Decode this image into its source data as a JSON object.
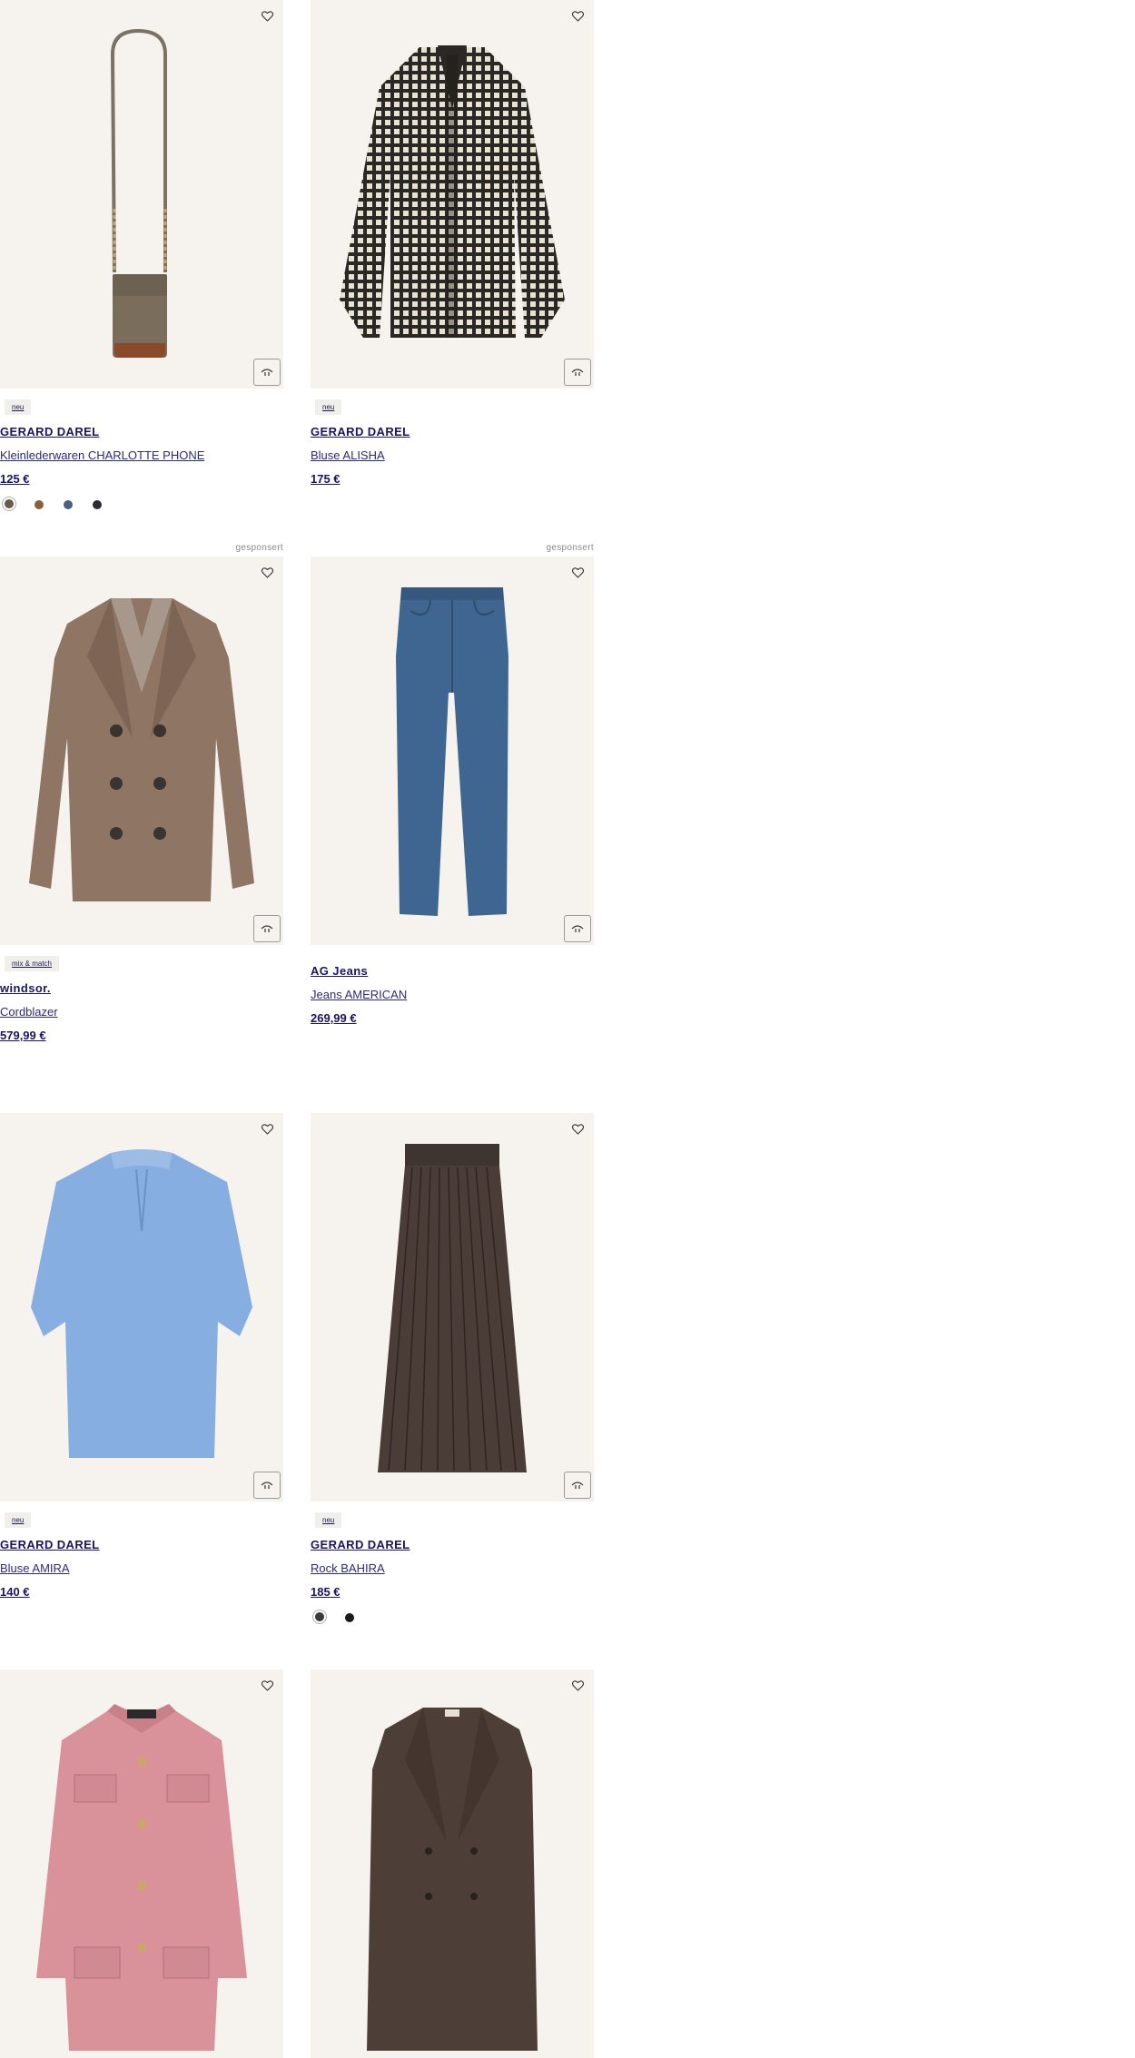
{
  "products": [
    {
      "badge": "neu",
      "brand": "GERARD DAREL",
      "name": "Kleinlederwaren CHARLOTTE PHONE",
      "price": "125 €",
      "swatches": [
        "#6b5a48",
        "#8a6038",
        "#4a5f82",
        "#2a2b33"
      ],
      "image": "crossbody-phone-bag"
    },
    {
      "badge": "neu",
      "brand": "GERARD DAREL",
      "name": "Bluse ALISHA",
      "price": "175 €",
      "swatches": [],
      "image": "checked-blouse"
    },
    {
      "sponsored": "gesponsert",
      "badge": "mix & match",
      "brand": "windsor.",
      "name": "Cordblazer",
      "price": "579,99 €",
      "swatches": [],
      "image": "corduroy-blazer"
    },
    {
      "sponsored": "gesponsert",
      "badge": "",
      "brand": "AG Jeans",
      "name": "Jeans AMERICAN",
      "price": "269,99 €",
      "swatches": [],
      "image": "blue-jeans"
    },
    {
      "badge": "neu",
      "brand": "GERARD DAREL",
      "name": "Bluse AMIRA",
      "price": "140 €",
      "swatches": [],
      "image": "light-blue-blouse"
    },
    {
      "badge": "neu",
      "brand": "GERARD DAREL",
      "name": "Rock BAHIRA",
      "price": "185 €",
      "swatches": [
        "#3a3a3a",
        "#1a1a1a"
      ],
      "image": "pleated-skirt"
    },
    {
      "image": "pink-knit-jacket"
    },
    {
      "image": "brown-coat"
    }
  ],
  "icons": {
    "wishlist": "heart-icon",
    "quick_view": "quick-view-icon"
  }
}
